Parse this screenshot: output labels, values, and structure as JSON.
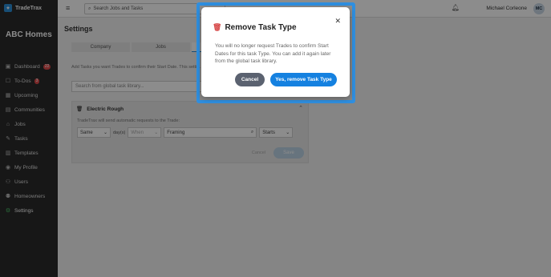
{
  "app": {
    "name": "TradeTrax",
    "company": "ABC Homes"
  },
  "sidebar": {
    "items": [
      {
        "label": "Dashboard",
        "icon": "dashboard-icon",
        "glyph": "▣",
        "badge": "22"
      },
      {
        "label": "To-Dos",
        "icon": "todo-icon",
        "glyph": "☐",
        "badge": "3"
      },
      {
        "label": "Upcoming",
        "icon": "calendar-icon",
        "glyph": "▦",
        "badge": null
      },
      {
        "label": "Communities",
        "icon": "map-icon",
        "glyph": "▤",
        "badge": null
      },
      {
        "label": "Jobs",
        "icon": "house-icon",
        "glyph": "⌂",
        "badge": null
      },
      {
        "label": "Tasks",
        "icon": "wrench-icon",
        "glyph": "✎",
        "badge": null
      },
      {
        "label": "Templates",
        "icon": "template-icon",
        "glyph": "▥",
        "badge": null
      },
      {
        "label": "My Profile",
        "icon": "profile-icon",
        "glyph": "◉",
        "badge": null
      },
      {
        "label": "Users",
        "icon": "users-icon",
        "glyph": "⚇",
        "badge": null
      },
      {
        "label": "Homeowners",
        "icon": "homeowners-icon",
        "glyph": "⚉",
        "badge": null
      },
      {
        "label": "Settings",
        "icon": "gear-icon",
        "glyph": "⚙",
        "badge": null
      }
    ]
  },
  "topbar": {
    "search_placeholder": "Search Jobs and Tasks",
    "user_name": "Michael Corleone",
    "avatar_initials": "MC"
  },
  "page": {
    "title": "Settings",
    "tabs": [
      "Company",
      "Jobs",
      "Start Da"
    ],
    "description": "Add Tasks you want Trades to confirm their Start Date. This setti... Template.",
    "library_search_placeholder": "Search from global task library..."
  },
  "task_card": {
    "title": "Electric Rough",
    "note": "TradeTrax will send automatic requests to the Trade:",
    "timing": "Same",
    "days_label": "day(s)",
    "when_placeholder": "When",
    "reference_task": "Framing",
    "event": "Starts",
    "cancel_label": "Cancel",
    "save_label": "Save"
  },
  "modal": {
    "title": "Remove Task Type",
    "body": "You will no longer request Trades to confirm Start Dates for this task Type. You can add it again later from the global task library.",
    "cancel_label": "Cancel",
    "confirm_label": "Yes, remove Task Type"
  },
  "colors": {
    "accent": "#1581e0",
    "sidebar_bg": "#2b2b2b",
    "danger": "#d64545",
    "active_green": "#4cc36a"
  }
}
